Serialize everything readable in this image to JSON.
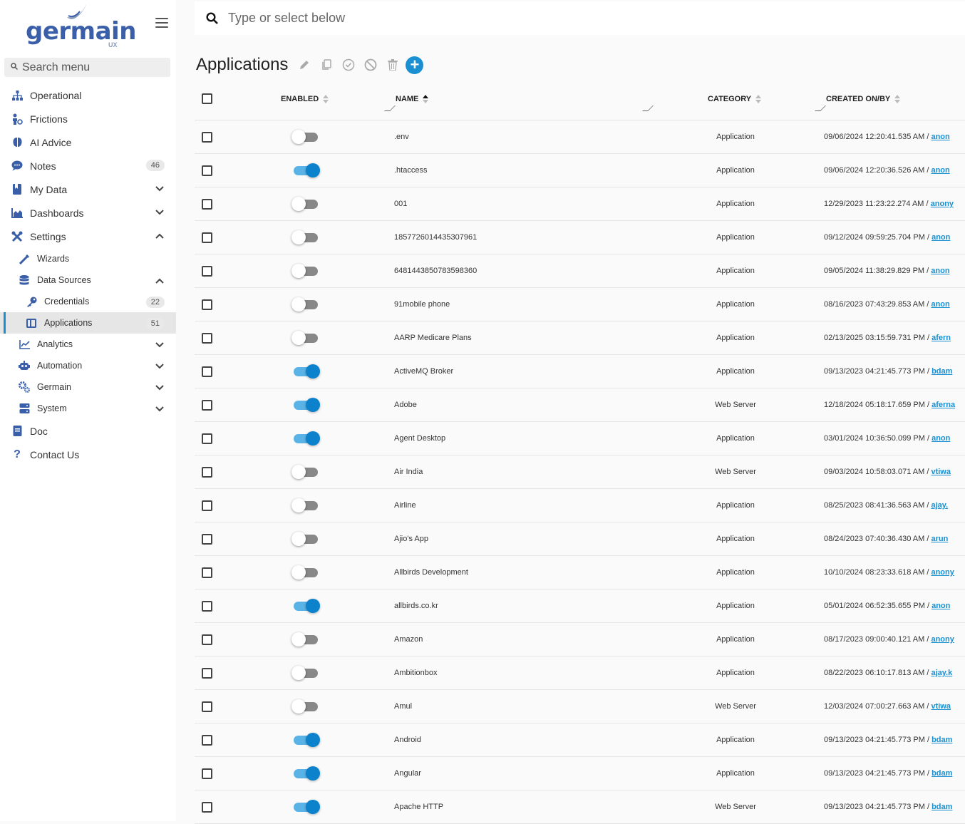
{
  "brand": {
    "name": "germain",
    "suffix": "UX"
  },
  "sidebar": {
    "search_placeholder": "Search menu",
    "items": [
      {
        "label": "Operational",
        "icon": "sitemap-icon"
      },
      {
        "label": "Frictions",
        "icon": "person-gear-icon"
      },
      {
        "label": "AI Advice",
        "icon": "brain-icon"
      },
      {
        "label": "Notes",
        "icon": "comment-icon",
        "badge": "46"
      },
      {
        "label": "My Data",
        "icon": "book-icon"
      },
      {
        "label": "Dashboards",
        "icon": "chart-area-icon"
      },
      {
        "label": "Settings",
        "icon": "tools-icon"
      },
      {
        "label": "Wizards",
        "icon": "wand-icon"
      },
      {
        "label": "Data Sources",
        "icon": "database-icon"
      },
      {
        "label": "Credentials",
        "icon": "key-icon",
        "badge": "22"
      },
      {
        "label": "Applications",
        "icon": "app-window-icon",
        "badge": "51"
      },
      {
        "label": "Analytics",
        "icon": "line-chart-icon"
      },
      {
        "label": "Automation",
        "icon": "robot-icon"
      },
      {
        "label": "Germain",
        "icon": "cogs-icon"
      },
      {
        "label": "System",
        "icon": "server-icon"
      },
      {
        "label": "Doc",
        "icon": "doc-icon"
      },
      {
        "label": "Contact Us",
        "icon": "question-icon"
      }
    ]
  },
  "topbar": {
    "placeholder": "Type or select below"
  },
  "page": {
    "title": "Applications"
  },
  "table": {
    "headers": {
      "enabled": "ENABLED",
      "name": "NAME",
      "category": "CATEGORY",
      "created": "CREATED ON/BY"
    },
    "rows": [
      {
        "enabled": false,
        "name": ".env",
        "category": "Application",
        "created_on": "09/06/2024 12:20:41.535 AM /",
        "created_by": "anon"
      },
      {
        "enabled": true,
        "name": ".htaccess",
        "category": "Application",
        "created_on": "09/06/2024 12:20:36.526 AM /",
        "created_by": "anon"
      },
      {
        "enabled": false,
        "name": "001",
        "category": "Application",
        "created_on": "12/29/2023 11:23:22.274 AM /",
        "created_by": "anony"
      },
      {
        "enabled": false,
        "name": "1857726014435307961",
        "category": "Application",
        "created_on": "09/12/2024 09:59:25.704 PM /",
        "created_by": "anon"
      },
      {
        "enabled": false,
        "name": "6481443850783598360",
        "category": "Application",
        "created_on": "09/05/2024 11:38:29.829 PM /",
        "created_by": "anon"
      },
      {
        "enabled": false,
        "name": "91mobile phone",
        "category": "Application",
        "created_on": "08/16/2023 07:43:29.853 AM /",
        "created_by": "anon"
      },
      {
        "enabled": false,
        "name": "AARP Medicare Plans",
        "category": "Application",
        "created_on": "02/13/2025 03:15:59.731 PM /",
        "created_by": "afern"
      },
      {
        "enabled": true,
        "name": "ActiveMQ Broker",
        "category": "Application",
        "created_on": "09/13/2023 04:21:45.773 PM /",
        "created_by": "bdam"
      },
      {
        "enabled": true,
        "name": "Adobe",
        "category": "Web Server",
        "created_on": "12/18/2024 05:18:17.659 PM /",
        "created_by": "aferna"
      },
      {
        "enabled": true,
        "name": "Agent Desktop",
        "category": "Application",
        "created_on": "03/01/2024 10:36:50.099 PM /",
        "created_by": "anon"
      },
      {
        "enabled": false,
        "name": "Air India",
        "category": "Web Server",
        "created_on": "09/03/2024 10:58:03.071 AM /",
        "created_by": "vtiwa"
      },
      {
        "enabled": false,
        "name": "Airline",
        "category": "Application",
        "created_on": "08/25/2023 08:41:36.563 AM /",
        "created_by": "ajay."
      },
      {
        "enabled": false,
        "name": "Ajio's App",
        "category": "Application",
        "created_on": "08/24/2023 07:40:36.430 AM /",
        "created_by": "arun"
      },
      {
        "enabled": false,
        "name": "Allbirds Development",
        "category": "Application",
        "created_on": "10/10/2024 08:23:33.618 AM /",
        "created_by": "anony"
      },
      {
        "enabled": true,
        "name": "allbirds.co.kr",
        "category": "Application",
        "created_on": "05/01/2024 06:52:35.655 PM /",
        "created_by": "anon"
      },
      {
        "enabled": false,
        "name": "Amazon",
        "category": "Application",
        "created_on": "08/17/2023 09:00:40.121 AM /",
        "created_by": "anony"
      },
      {
        "enabled": false,
        "name": "Ambitionbox",
        "category": "Application",
        "created_on": "08/22/2023 06:10:17.813 AM /",
        "created_by": "ajay.k"
      },
      {
        "enabled": false,
        "name": "Amul",
        "category": "Web Server",
        "created_on": "12/03/2024 07:00:27.663 AM /",
        "created_by": "vtiwa"
      },
      {
        "enabled": true,
        "name": "Android",
        "category": "Application",
        "created_on": "09/13/2023 04:21:45.773 PM /",
        "created_by": "bdam"
      },
      {
        "enabled": true,
        "name": "Angular",
        "category": "Application",
        "created_on": "09/13/2023 04:21:45.773 PM /",
        "created_by": "bdam"
      },
      {
        "enabled": true,
        "name": "Apache HTTP",
        "category": "Web Server",
        "created_on": "09/13/2023 04:21:45.773 PM /",
        "created_by": "bdam"
      }
    ]
  },
  "colors": {
    "accent": "#1a8fd1",
    "brand": "#3a5fa8",
    "toggle_on": "#0d82cc",
    "toggle_off": "#888888"
  }
}
